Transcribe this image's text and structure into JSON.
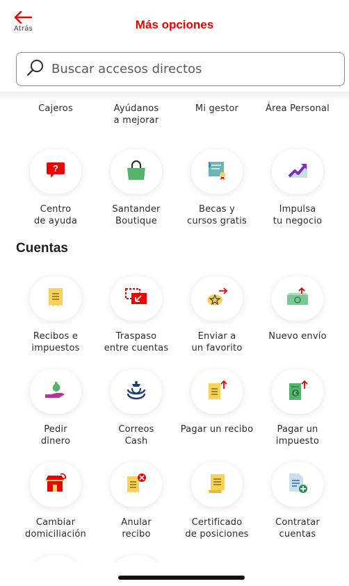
{
  "header": {
    "back_label": "Atrás",
    "title": "Más opciones"
  },
  "search": {
    "placeholder": "Buscar accesos directos"
  },
  "top_row": [
    "Cajeros",
    "Ayúdanos\na mejorar",
    "Mi gestor",
    "Área Personal"
  ],
  "row2": [
    {
      "label": "Centro\nde ayuda",
      "icon": "help-icon"
    },
    {
      "label": "Santander\nBoutique",
      "icon": "shopping-bag-icon"
    },
    {
      "label": "Becas y\ncursos gratis",
      "icon": "certificate-icon"
    },
    {
      "label": "Impulsa\ntu negocio",
      "icon": "growth-chart-icon"
    }
  ],
  "section": {
    "title": "Cuentas"
  },
  "accounts": [
    {
      "label": "Recibos e\nimpuestos",
      "icon": "receipt-icon"
    },
    {
      "label": "Traspaso\nentre cuentas",
      "icon": "transfer-icon"
    },
    {
      "label": "Enviar a\nun favorito",
      "icon": "send-favorite-icon"
    },
    {
      "label": "Nuevo envío",
      "icon": "new-transfer-icon"
    },
    {
      "label": "Pedir\ndinero",
      "icon": "request-money-icon"
    },
    {
      "label": "Correos\nCash",
      "icon": "correos-icon"
    },
    {
      "label": "Pagar un recibo",
      "icon": "pay-receipt-icon"
    },
    {
      "label": "Pagar un\nimpuesto",
      "icon": "pay-tax-icon"
    },
    {
      "label": "Cambiar\ndomiciliación",
      "icon": "store-change-icon"
    },
    {
      "label": "Anular\nrecibo",
      "icon": "cancel-receipt-icon"
    },
    {
      "label": "Certificado\nde posiciones",
      "icon": "certificate-scroll-icon"
    },
    {
      "label": "Contratar\ncuentas",
      "icon": "add-document-icon"
    }
  ],
  "colors": {
    "brand_red": "#ec0000",
    "yellow": "#f7d25a",
    "green": "#56b36b",
    "teal": "#6bb6b4",
    "purple": "#7b2fbf"
  }
}
